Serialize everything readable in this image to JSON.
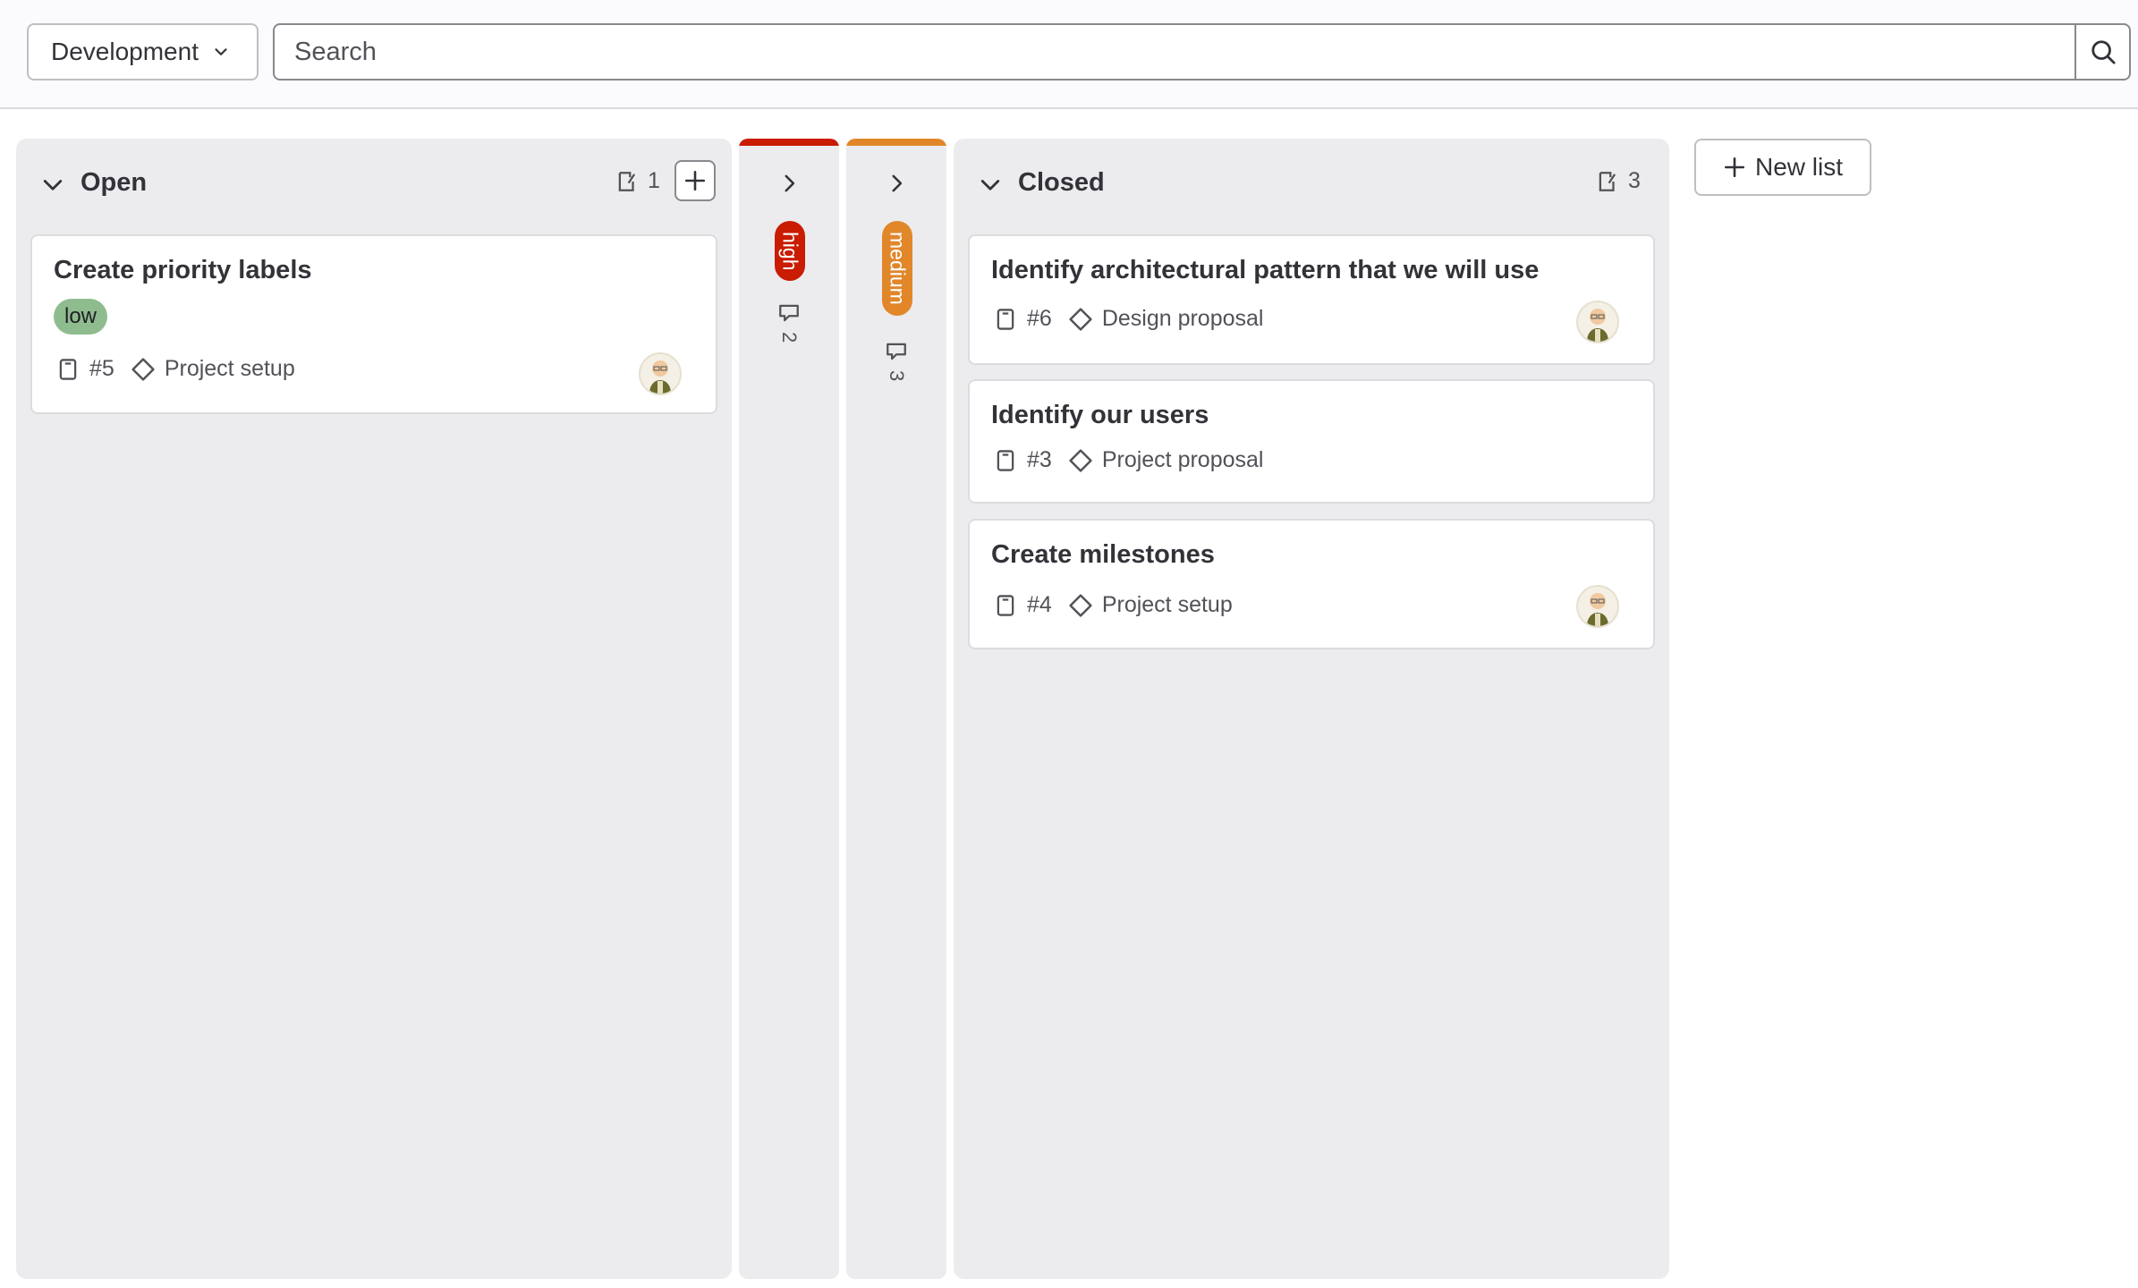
{
  "header": {
    "scope_label": "Development",
    "search_placeholder": "Search"
  },
  "lists": {
    "open": {
      "title": "Open",
      "count": "1",
      "cards": [
        {
          "title": "Create priority labels",
          "label": "low",
          "number": "#5",
          "milestone": "Project setup"
        }
      ]
    },
    "high": {
      "label": "high",
      "count": "2",
      "color": "#dd2b0e"
    },
    "medium": {
      "label": "medium",
      "count": "3",
      "color": "#e1872a"
    },
    "closed": {
      "title": "Closed",
      "count": "3",
      "cards": [
        {
          "title": "Identify architectural pattern that we will use",
          "number": "#6",
          "milestone": "Design proposal"
        },
        {
          "title": "Identify our users",
          "number": "#3",
          "milestone": "Project proposal"
        },
        {
          "title": "Create milestones",
          "number": "#4",
          "milestone": "Project setup"
        }
      ]
    }
  },
  "actions": {
    "new_list_label": "New list"
  },
  "colors": {
    "low_label": "#8fbc8f",
    "high_lane": "#c91c00",
    "medium_lane": "#e1872a"
  }
}
